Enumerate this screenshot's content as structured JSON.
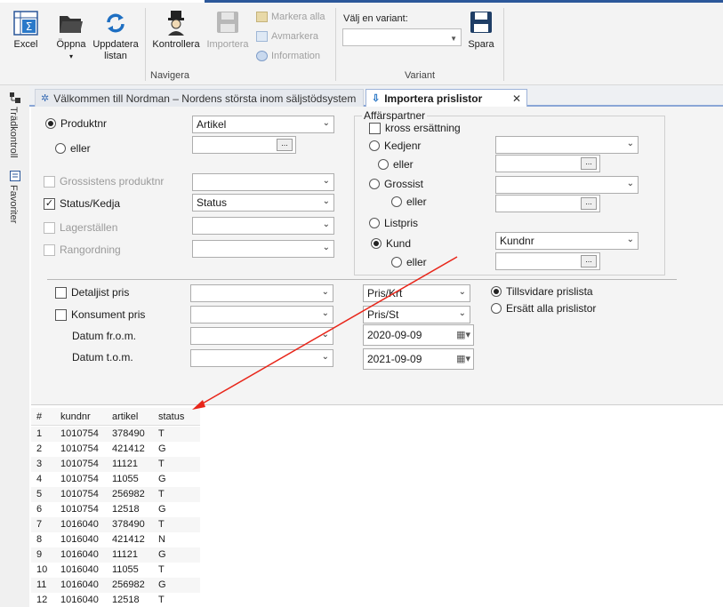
{
  "ribbon": {
    "excel_label": "Excel",
    "oppna_label": "Öppna",
    "oppna_arrow": "▾",
    "uppdatera_label_1": "Uppdatera",
    "uppdatera_label_2": "listan",
    "kontrollera_label": "Kontrollera",
    "importera_label": "Importera",
    "markera_alla_label": "Markera alla",
    "avmarkera_label": "Avmarkera",
    "information_label": "Information",
    "navigera_group": "Navigera",
    "variant_label": "Välj en variant:",
    "spara_label": "Spara",
    "variant_group": "Variant"
  },
  "sidebar": {
    "tradkontroll": "Trädkontroll",
    "favoriter": "Favoriter"
  },
  "tabs": [
    {
      "label": "Välkommen till Nordman – Nordens största inom säljstödsystem"
    },
    {
      "label": "Importera prislistor",
      "close": "✕"
    }
  ],
  "form": {
    "produktnr_label": "Produktnr",
    "produktnr_combo": "Artikel",
    "eller_label": "eller",
    "grossistens_produktnr_label": "Grossistens produktnr",
    "status_kedja_label": "Status/Kedja",
    "status_combo": "Status",
    "lagerstallen_label": "Lagerställen",
    "rangordning_label": "Rangordning",
    "affarspartner_title": "Affärspartner",
    "kross_ersattning_label": "kross ersättning",
    "kedjenr_label": "Kedjenr",
    "grossist_label": "Grossist",
    "listpris_label": "Listpris",
    "kund_label": "Kund",
    "kund_combo": "Kundnr",
    "detaljist_pris_label": "Detaljist pris",
    "konsument_pris_label": "Konsument pris",
    "datum_from_label": "Datum fr.o.m.",
    "datum_tom_label": "Datum t.o.m.",
    "pris_krt": "Pris/Krt",
    "pris_st": "Pris/St",
    "date_from": "2020-09-09",
    "date_tom": "2021-09-09",
    "tillsvidare_label": "Tillsvidare prislista",
    "ersatt_label": "Ersätt alla prislistor",
    "dots": "...",
    "combo_arrow": "⌄",
    "calendar_glyph": "▦▾"
  },
  "grid": {
    "headers": [
      "#",
      "kundnr",
      "artikel",
      "status"
    ],
    "rows": [
      [
        "1",
        "1010754",
        "378490",
        "T"
      ],
      [
        "2",
        "1010754",
        "421412",
        "G"
      ],
      [
        "3",
        "1010754",
        "11121",
        "T"
      ],
      [
        "4",
        "1010754",
        "11055",
        "G"
      ],
      [
        "5",
        "1010754",
        "256982",
        "T"
      ],
      [
        "6",
        "1010754",
        "12518",
        "G"
      ],
      [
        "7",
        "1016040",
        "378490",
        "T"
      ],
      [
        "8",
        "1016040",
        "421412",
        "N"
      ],
      [
        "9",
        "1016040",
        "11121",
        "G"
      ],
      [
        "10",
        "1016040",
        "11055",
        "T"
      ],
      [
        "11",
        "1016040",
        "256982",
        "G"
      ],
      [
        "12",
        "1016040",
        "12518",
        "T"
      ]
    ]
  },
  "colors": {
    "accent": "#2b579a",
    "annotation_arrow": "#e8261a"
  },
  "icons": [
    "excel-icon",
    "folder-open-icon",
    "refresh-icon",
    "inspector-icon",
    "floppy-disk-icon",
    "markera-icon",
    "avmarkera-icon",
    "information-icon",
    "tree-icon",
    "favorites-icon",
    "tree-tab-icon",
    "import-tab-icon",
    "close-icon",
    "calendar-icon"
  ]
}
